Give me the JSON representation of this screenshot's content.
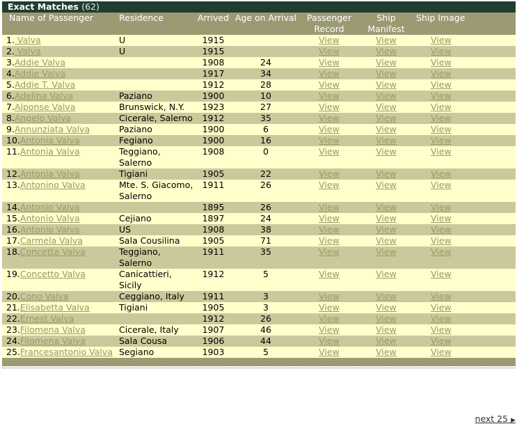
{
  "header": {
    "title": "Exact Matches",
    "count": "(62)"
  },
  "columns": {
    "name": "Name of Passenger",
    "residence": "Residence",
    "arrived": "Arrived",
    "age": "Age on Arrival",
    "record_1": "Passenger",
    "record_2": "Record",
    "manifest_1": "Ship",
    "manifest_2": "Manifest",
    "image": "Ship Image"
  },
  "link_label": "View",
  "rows": [
    {
      "n": "1.",
      "name": " Valva",
      "residence": "U",
      "arrived": "1915",
      "age": ""
    },
    {
      "n": "2.",
      "name": " Valva",
      "residence": "U",
      "arrived": "1915",
      "age": ""
    },
    {
      "n": "3.",
      "name": "Addie Valva",
      "residence": "",
      "arrived": "1908",
      "age": "24"
    },
    {
      "n": "4.",
      "name": "Addie Valva",
      "residence": "",
      "arrived": "1917",
      "age": "34"
    },
    {
      "n": "5.",
      "name": "Addie T. Valva",
      "residence": "",
      "arrived": "1912",
      "age": "28"
    },
    {
      "n": "6.",
      "name": "Adelina Valva",
      "residence": "Paziano",
      "arrived": "1900",
      "age": "10"
    },
    {
      "n": "7.",
      "name": "Alponse Valva",
      "residence": "Brunswick, N.Y.",
      "arrived": "1923",
      "age": "27"
    },
    {
      "n": "8.",
      "name": "Angelo Valva",
      "residence": "Cicerale, Salerno",
      "arrived": "1912",
      "age": "35"
    },
    {
      "n": "9.",
      "name": "Annunziata Valva",
      "residence": "Paziano",
      "arrived": "1900",
      "age": "6"
    },
    {
      "n": "10.",
      "name": "Antonia Valva",
      "residence": "Fegiano",
      "arrived": "1900",
      "age": "16"
    },
    {
      "n": "11.",
      "name": "Antonia Valva",
      "residence": "Teggiano, Salerno",
      "arrived": "1908",
      "age": "0"
    },
    {
      "n": "12.",
      "name": "Antonia Valva",
      "residence": "Tigiani",
      "arrived": "1905",
      "age": "22"
    },
    {
      "n": "13.",
      "name": "Antonino Valva",
      "residence": "Mte. S. Giacomo, Salerno",
      "arrived": "1911",
      "age": "26"
    },
    {
      "n": "14.",
      "name": "Antonio Valva",
      "residence": "",
      "arrived": "1895",
      "age": "26"
    },
    {
      "n": "15.",
      "name": "Antonio Valva",
      "residence": "Cejiano",
      "arrived": "1897",
      "age": "24"
    },
    {
      "n": "16.",
      "name": "Antonio Valva",
      "residence": "US",
      "arrived": "1908",
      "age": "38"
    },
    {
      "n": "17.",
      "name": "Carmela Valva",
      "residence": "Sala Cousilina",
      "arrived": "1905",
      "age": "71"
    },
    {
      "n": "18.",
      "name": "Concetta Valva",
      "residence": "Teggiano, Salerno",
      "arrived": "1911",
      "age": "35"
    },
    {
      "n": "19.",
      "name": "Concetto Valva",
      "residence": "Canicattieri, Sicily",
      "arrived": "1912",
      "age": "5"
    },
    {
      "n": "20.",
      "name": "Cono Valva",
      "residence": "Ceggiano, Italy",
      "arrived": "1911",
      "age": "3"
    },
    {
      "n": "21.",
      "name": "Elisabetta Valva",
      "residence": "Tigiani",
      "arrived": "1905",
      "age": "3"
    },
    {
      "n": "22.",
      "name": "Ernest Valva",
      "residence": "",
      "arrived": "1912",
      "age": "26"
    },
    {
      "n": "23.",
      "name": "Filomena Valva",
      "residence": "Cicerale, Italy",
      "arrived": "1907",
      "age": "46"
    },
    {
      "n": "24.",
      "name": "Filomena Valva",
      "residence": "Sala Cousa",
      "arrived": "1906",
      "age": "44"
    },
    {
      "n": "25.",
      "name": "Francesantonio Valva",
      "residence": "Segiano",
      "arrived": "1903",
      "age": "5"
    }
  ],
  "pager": {
    "next": "next 25"
  }
}
